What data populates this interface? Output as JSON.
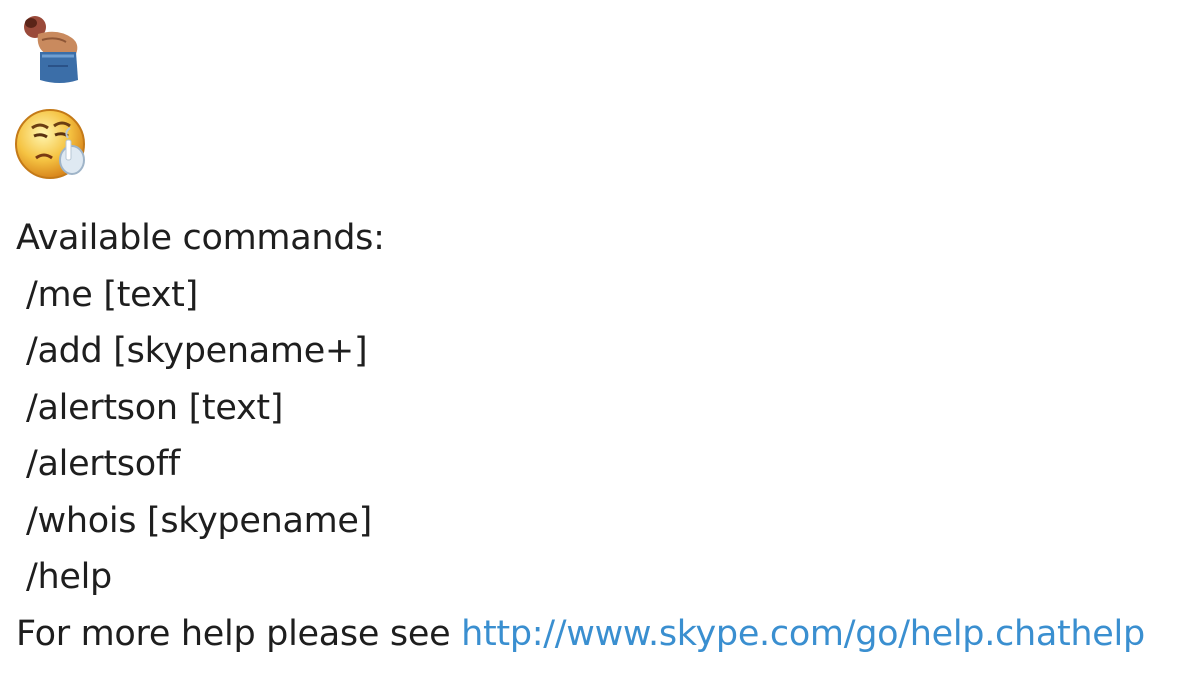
{
  "chat": {
    "emoticons": [
      {
        "icon": "bowing-person-emoticon"
      },
      {
        "icon": "smoking-emoticon"
      }
    ],
    "heading": "Available commands:",
    "commands": [
      " /me [text]",
      " /add [skypename+]",
      " /alertson [text]",
      " /alertsoff",
      " /whois [skypename]",
      " /help"
    ],
    "help_text": "For more help please see ",
    "help_link": "http://www.skype.com/go/help.chathelp"
  },
  "colors": {
    "text": "#1e1e1e",
    "link": "#3a8fd0",
    "background": "#ffffff"
  }
}
